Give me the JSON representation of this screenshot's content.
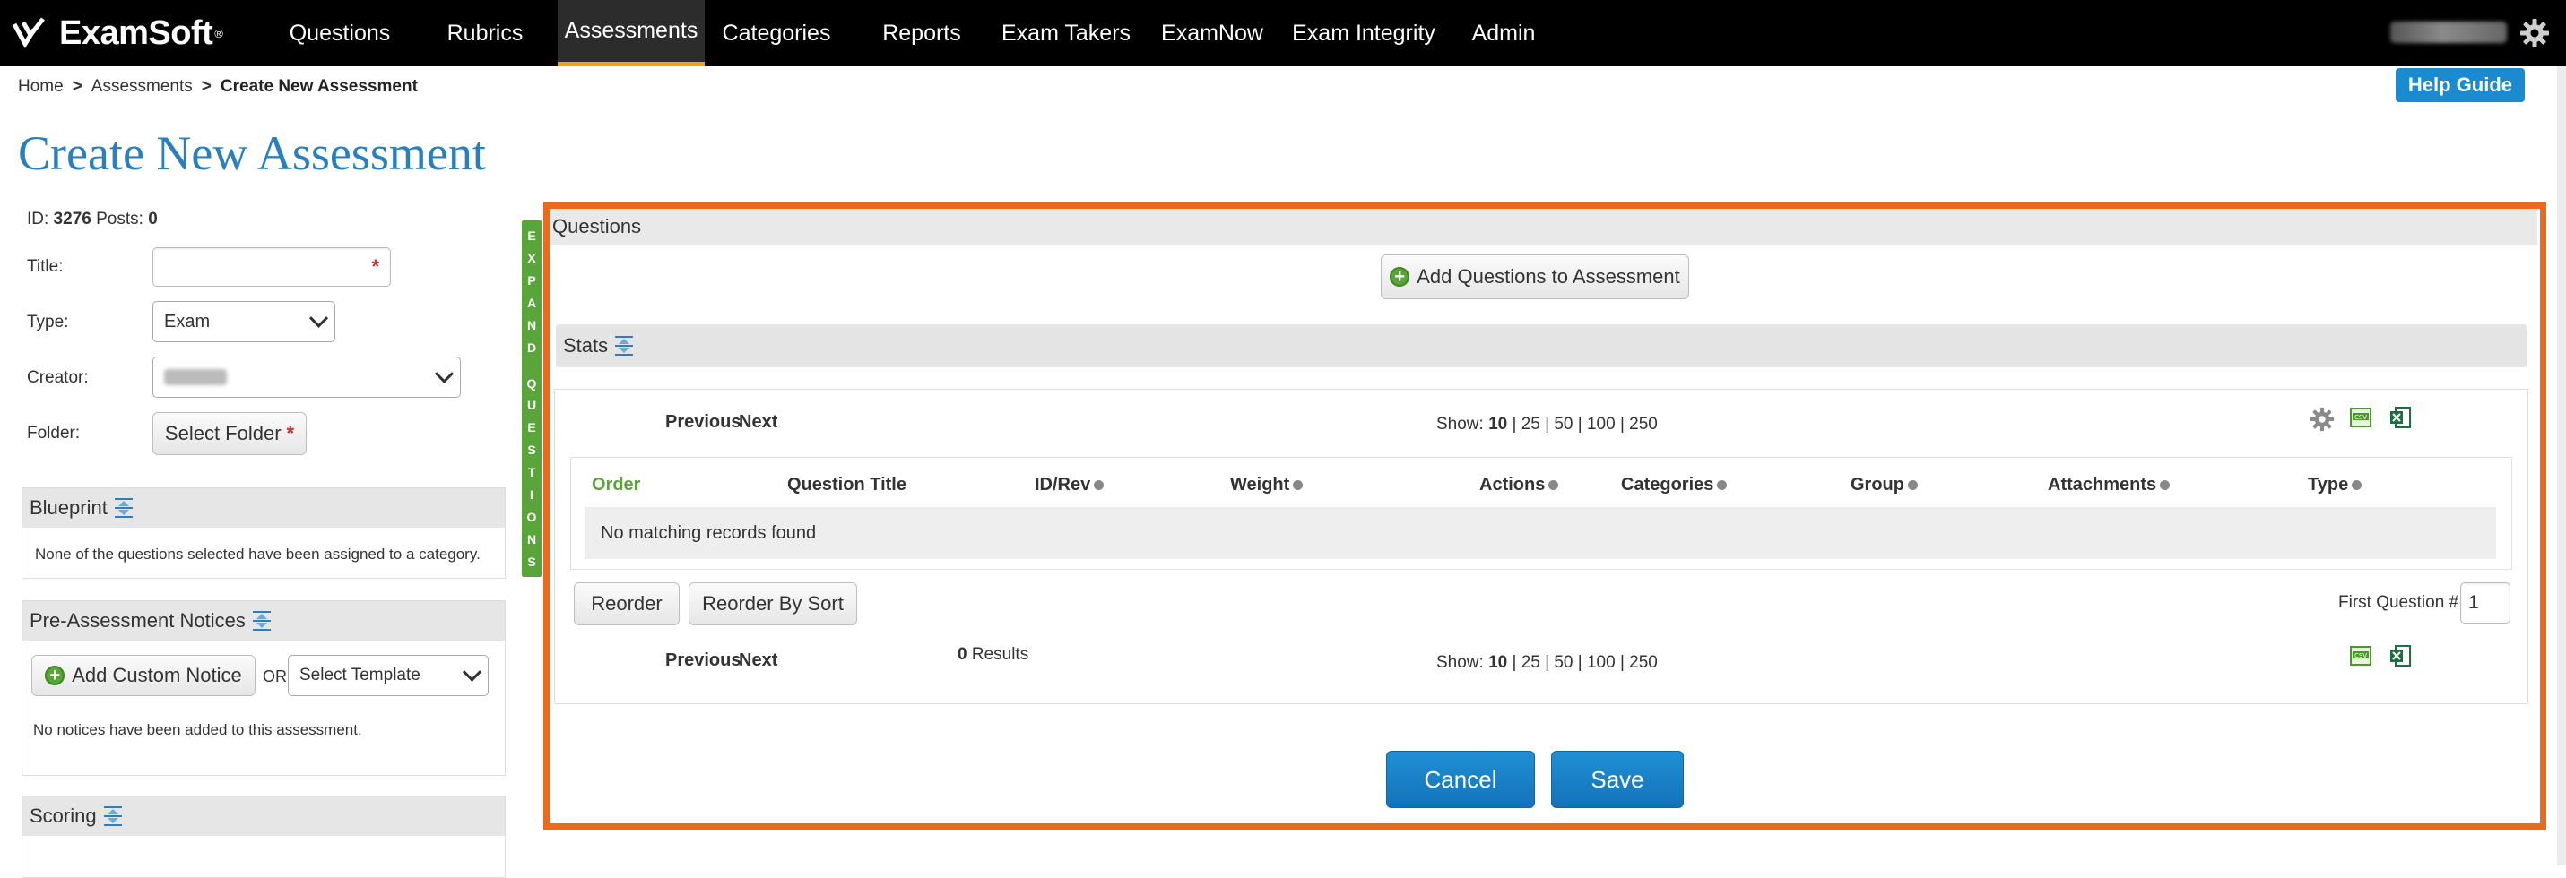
{
  "app": {
    "logo_text": "ExamSoft",
    "logo_tm": "®"
  },
  "nav": {
    "items": [
      {
        "label": "Questions"
      },
      {
        "label": "Rubrics"
      },
      {
        "label": "Assessments"
      },
      {
        "label": "Categories"
      },
      {
        "label": "Reports"
      },
      {
        "label": "Exam Takers"
      },
      {
        "label": "ExamNow"
      },
      {
        "label": "Exam Integrity"
      },
      {
        "label": "Admin"
      }
    ],
    "active": "Assessments"
  },
  "breadcrumb": {
    "home": "Home",
    "sep": ">",
    "assessments": "Assessments",
    "current": "Create New Assessment"
  },
  "help_guide": "Help Guide",
  "page_title": "Create New Assessment",
  "form": {
    "id_label": "ID:",
    "id_value": "3276",
    "posts_label": "Posts:",
    "posts_value": "0",
    "title_label": "Title:",
    "title_value": "",
    "type_label": "Type:",
    "type_value": "Exam",
    "creator_label": "Creator:",
    "folder_label": "Folder:",
    "select_folder": "Select Folder",
    "required": "*"
  },
  "blueprint": {
    "title": "Blueprint",
    "message": "None of the questions selected have been assigned to a category."
  },
  "notices": {
    "title": "Pre-Assessment Notices",
    "add_button": "Add Custom Notice",
    "or": "OR",
    "template_value": "Select Template",
    "message": "No notices have been added to this assessment."
  },
  "scoring": {
    "title": "Scoring"
  },
  "expand_strip": {
    "letters": [
      "E",
      "X",
      "P",
      "A",
      "N",
      "D",
      "",
      "Q",
      "U",
      "E",
      "S",
      "T",
      "I",
      "O",
      "N",
      "S"
    ]
  },
  "questions": {
    "title": "Questions",
    "add_button": "Add Questions to Assessment",
    "stats_label": "Stats",
    "previous": "Previous",
    "next": "Next",
    "show_label": "Show:",
    "show_current": "10",
    "show_options": "| 25 | 50 | 100 | 250",
    "columns": [
      "Order",
      "Question Title",
      "ID/Rev",
      "Weight",
      "Actions",
      "Categories",
      "Group",
      "Attachments",
      "Type"
    ],
    "no_records": "No matching records found",
    "reorder": "Reorder",
    "reorder_by_sort": "Reorder By Sort",
    "first_question_label": "First Question #",
    "first_question_value": "1",
    "results_count": "0",
    "results_label": "Results"
  },
  "actions": {
    "cancel": "Cancel",
    "save": "Save"
  },
  "colors": {
    "brand_blue": "#2a7fbf",
    "highlight_orange": "#ec6a1c",
    "active_tab_underline": "#f0a11a",
    "green": "#5aa53a"
  },
  "icons": [
    "gear-icon",
    "collapse-icon",
    "plus-circle-icon",
    "csv-icon",
    "excel-icon",
    "chevron-down-icon"
  ]
}
